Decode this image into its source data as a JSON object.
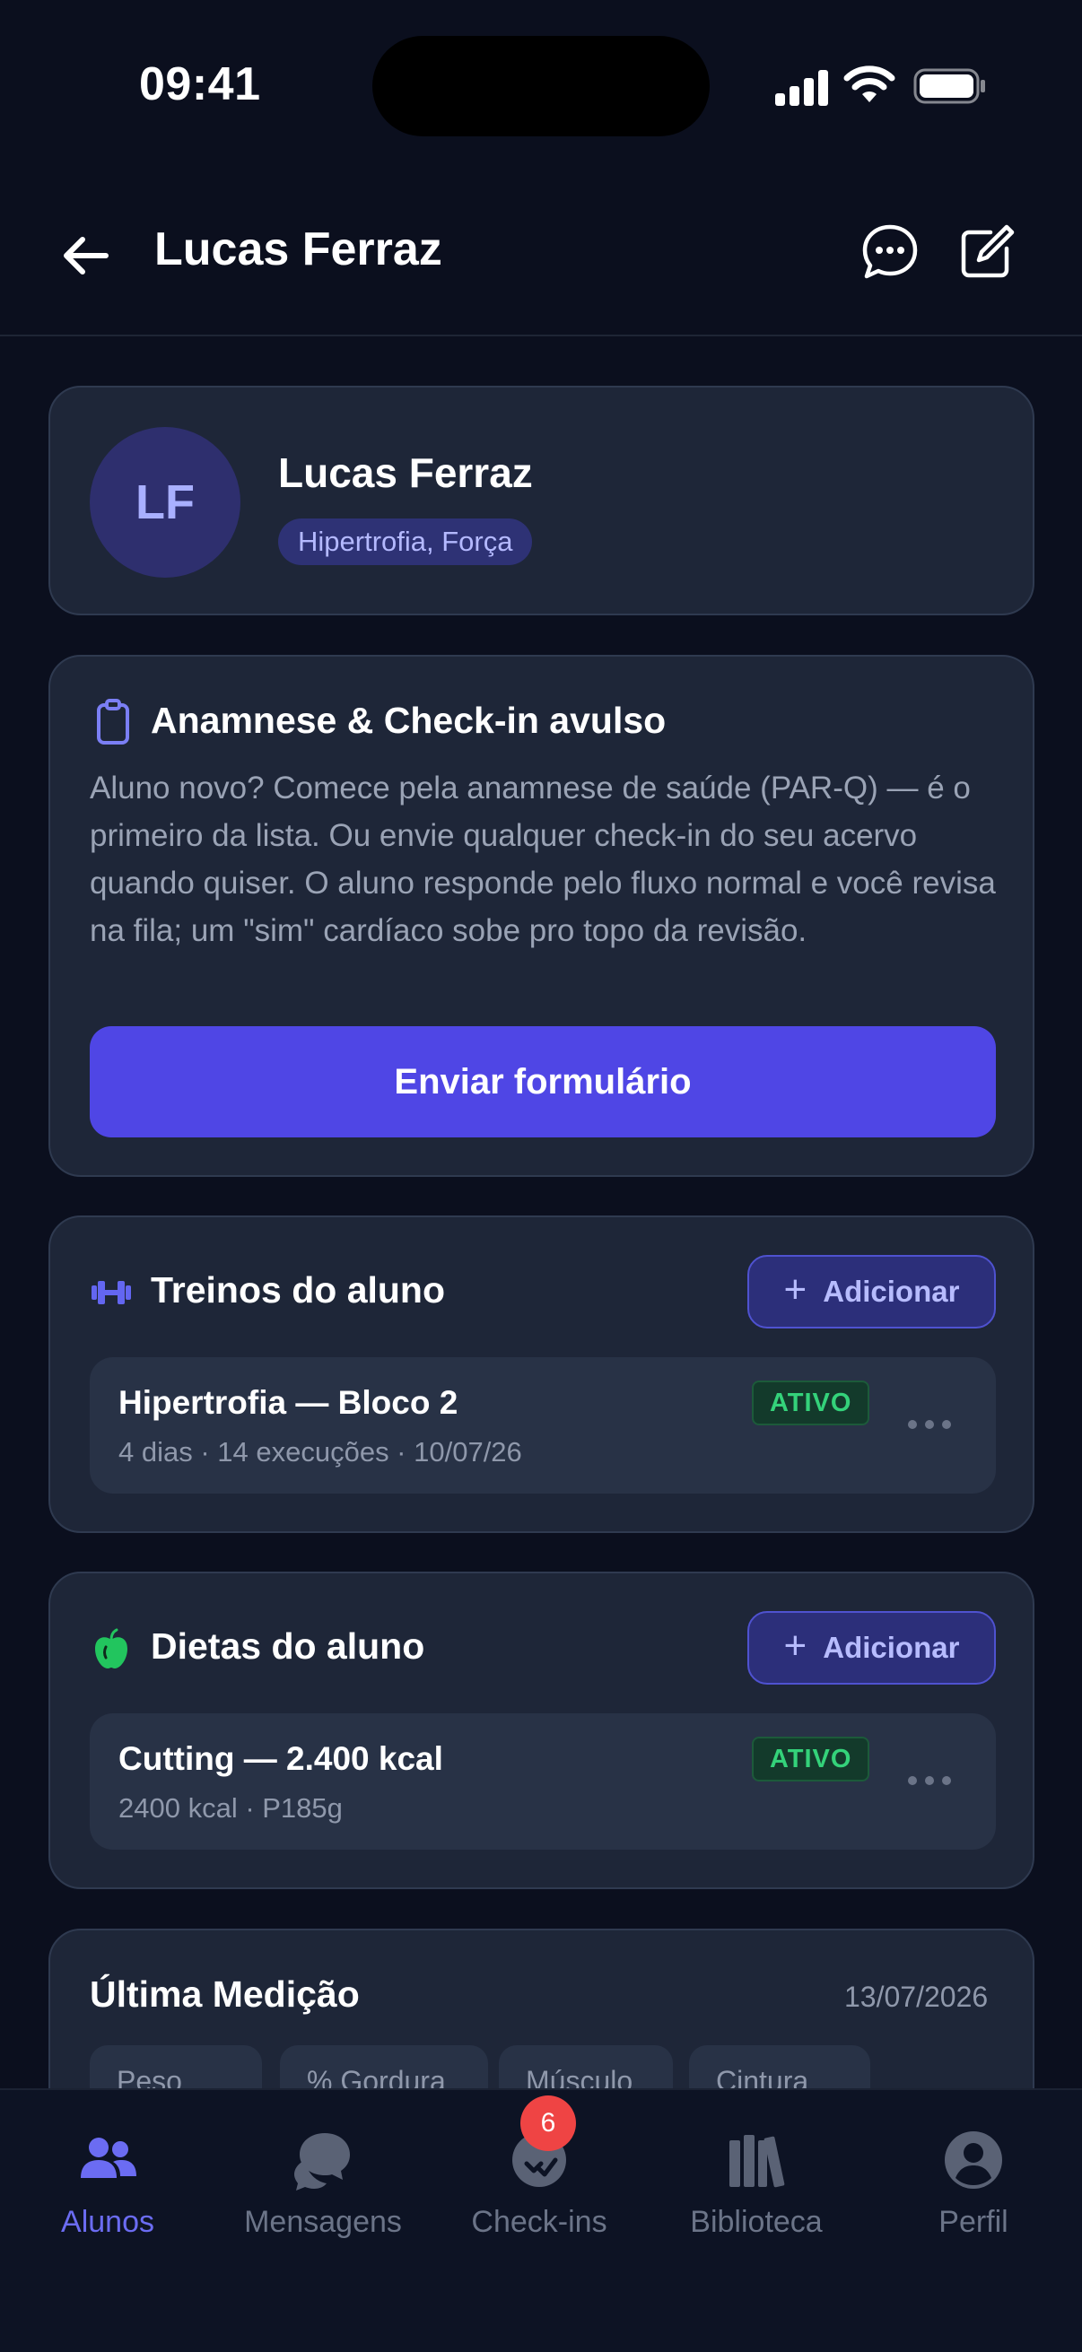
{
  "status_bar": {
    "time": "09:41"
  },
  "header": {
    "title": "Lucas Ferraz"
  },
  "profile": {
    "initials": "LF",
    "name": "Lucas Ferraz",
    "tag": "Hipertrofia, Força"
  },
  "form_card": {
    "title": "Anamnese & Check-in avulso",
    "description": "Aluno novo? Comece pela anamnese de saúde (PAR-Q) — é o primeiro da lista. Ou envie qualquer check-in do seu acervo quando quiser. O aluno responde pelo fluxo normal e você revisa na fila; um \"sim\" cardíaco sobe pro topo da revisão.",
    "button": "Enviar formulário"
  },
  "workouts": {
    "title": "Treinos do aluno",
    "add_label": "Adicionar",
    "items": [
      {
        "title": "Hipertrofia — Bloco 2",
        "subtitle": "4 dias · 14 execuções · 10/07/26",
        "status": "ATIVO"
      }
    ]
  },
  "diets": {
    "title": "Dietas do aluno",
    "add_label": "Adicionar",
    "items": [
      {
        "title": "Cutting — 2.400 kcal",
        "subtitle": "2400 kcal · P185g",
        "status": "ATIVO"
      }
    ]
  },
  "measurement": {
    "title": "Última Medição",
    "date": "13/07/2026",
    "metrics": [
      "Peso",
      "% Gordura",
      "Músculo",
      "Cintura"
    ]
  },
  "tabbar": {
    "tabs": [
      {
        "label": "Alunos",
        "icon": "users-icon",
        "active": true
      },
      {
        "label": "Mensagens",
        "icon": "chat-bubbles-icon",
        "active": false
      },
      {
        "label": "Check-ins",
        "icon": "checkin-icon",
        "active": false
      },
      {
        "label": "Biblioteca",
        "icon": "library-icon",
        "active": false
      },
      {
        "label": "Perfil",
        "icon": "profile-icon",
        "active": false
      }
    ],
    "checkins_badge": "6"
  },
  "colors": {
    "accent": "#4f46e5",
    "active_tab": "#6b6cf2",
    "status_green": "#34d27a",
    "badge_red": "#ef4444"
  }
}
